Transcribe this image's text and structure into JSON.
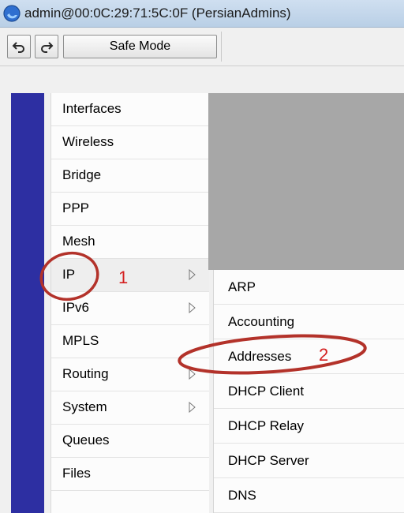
{
  "window": {
    "title": "admin@00:0C:29:71:5C:0F (PersianAdmins)"
  },
  "toolbar": {
    "undo_icon": "undo-icon",
    "redo_icon": "redo-icon",
    "safe_mode_label": "Safe Mode"
  },
  "menu": {
    "items": [
      {
        "label": "Interfaces",
        "submenu": false
      },
      {
        "label": "Wireless",
        "submenu": false
      },
      {
        "label": "Bridge",
        "submenu": false
      },
      {
        "label": "PPP",
        "submenu": false
      },
      {
        "label": "Mesh",
        "submenu": false
      },
      {
        "label": "IP",
        "submenu": true
      },
      {
        "label": "IPv6",
        "submenu": true
      },
      {
        "label": "MPLS",
        "submenu": false
      },
      {
        "label": "Routing",
        "submenu": true
      },
      {
        "label": "System",
        "submenu": true
      },
      {
        "label": "Queues",
        "submenu": false
      },
      {
        "label": "Files",
        "submenu": false
      }
    ]
  },
  "submenu": {
    "items": [
      {
        "label": "ARP"
      },
      {
        "label": "Accounting"
      },
      {
        "label": "Addresses"
      },
      {
        "label": "DHCP Client"
      },
      {
        "label": "DHCP Relay"
      },
      {
        "label": "DHCP Server"
      },
      {
        "label": "DNS"
      }
    ]
  },
  "annotations": {
    "step1": "1",
    "step2": "2",
    "color": "#d42020"
  }
}
